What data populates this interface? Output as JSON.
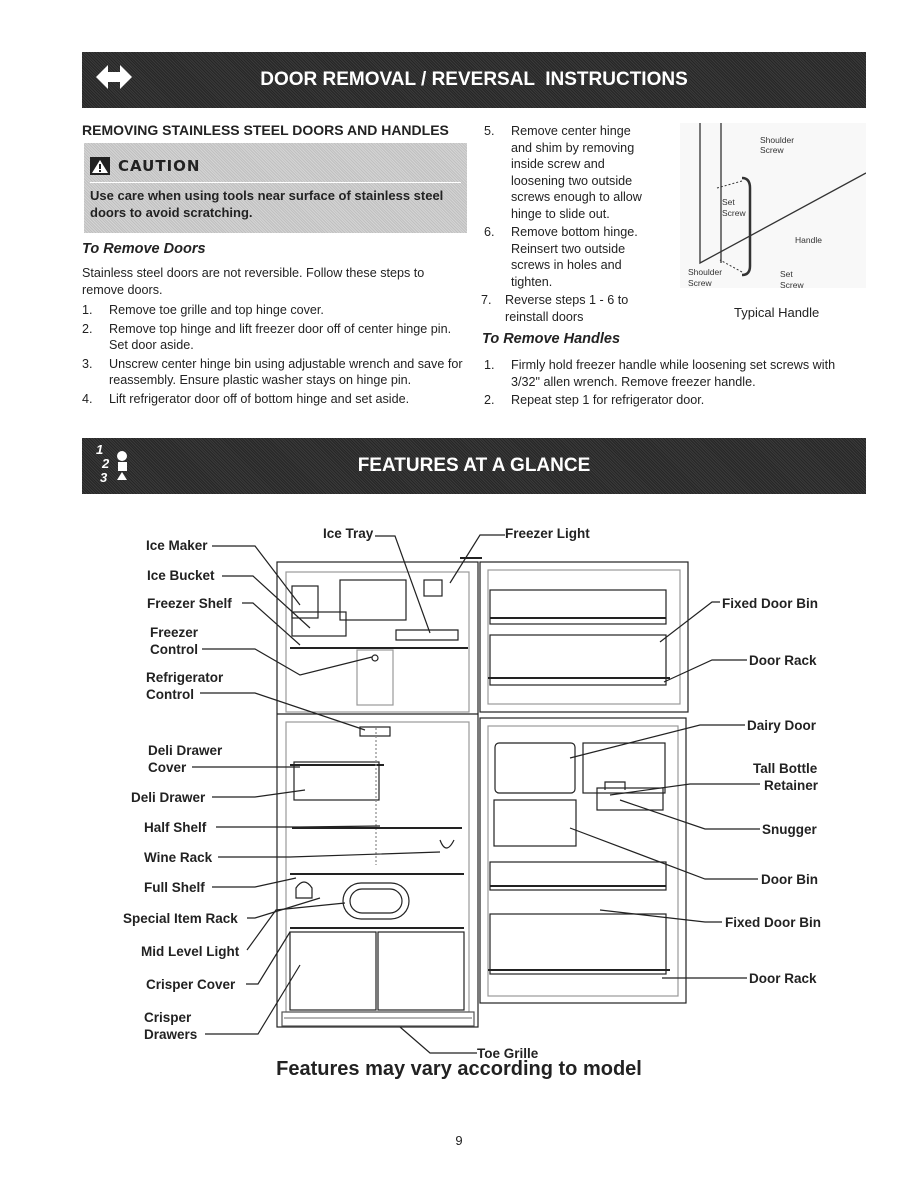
{
  "header1": {
    "title": "DOOR REMOVAL / REVERSAL  INSTRUCTIONS",
    "icon": "double-arrow-icon"
  },
  "section": {
    "title": "REMOVING STAINLESS STEEL DOORS AND HANDLES"
  },
  "caution": {
    "label": "CAUTION",
    "text": "Use care when using tools near surface of stainless steel doors to avoid scratching."
  },
  "remove_doors": {
    "title": "To Remove Doors",
    "intro": "Stainless steel doors are not reversible. Follow these steps to remove doors.",
    "steps": [
      {
        "n": "1.",
        "text": "Remove toe grille and top hinge cover."
      },
      {
        "n": "2.",
        "text": "Remove top hinge and lift freezer door off of center hinge pin. Set door aside."
      },
      {
        "n": "3.",
        "text": "Unscrew center hinge bin using adjustable wrench and save for reassembly. Ensure plastic washer stays on hinge pin."
      },
      {
        "n": "4.",
        "text": "Lift refrigerator door off of bottom hinge and set aside."
      },
      {
        "n": "5.",
        "text": "Remove center hinge and shim by removing inside screw and loosening two outside screws enough to allow hinge to slide out."
      },
      {
        "n": "6.",
        "text": "Remove bottom hinge. Reinsert two outside screws in holes and tighten."
      },
      {
        "n": "7.",
        "text": "Reverse steps 1 - 6 to reinstall doors"
      }
    ]
  },
  "handle_figure": {
    "caption": "Typical Handle",
    "labels": {
      "shoulder_top": "Shoulder",
      "screw_top": "Screw",
      "set1": "Set",
      "set1b": "Screw",
      "handle": "Handle",
      "shoulder_bot": "Shoulder",
      "screw_bot": "Screw",
      "set2": "Set",
      "set2b": "Screw"
    }
  },
  "remove_handles": {
    "title": "To Remove Handles",
    "steps": [
      {
        "n": "1.",
        "text": "Firmly hold freezer handle while loosening set screws with 3/32\" allen wrench. Remove freezer handle."
      },
      {
        "n": "2.",
        "text": "Repeat step 1 for refrigerator door."
      }
    ]
  },
  "header2": {
    "title": "FEATURES AT A GLANCE",
    "icon": "steps-123-icon"
  },
  "features": {
    "left": [
      "Ice Maker",
      "Ice Bucket",
      "Freezer Shelf",
      "Freezer",
      "Control",
      "Refrigerator",
      "Control",
      "Deli Drawer",
      "Cover",
      "Deli Drawer",
      "Half Shelf",
      "Wine Rack",
      "Full Shelf",
      "Special Item Rack",
      "Mid Level Light",
      "Crisper Cover",
      "Crisper",
      "Drawers"
    ],
    "top": [
      "Ice Tray",
      "Freezer Light"
    ],
    "right": [
      "Fixed Door Bin",
      "Door Rack",
      "Dairy Door",
      "Tall Bottle",
      "Retainer",
      "Snugger",
      "Door Bin",
      "Fixed Door Bin",
      "Door Rack"
    ],
    "bottom": "Toe Grille"
  },
  "footer": {
    "note": "Features may vary according to model",
    "page": "9"
  }
}
